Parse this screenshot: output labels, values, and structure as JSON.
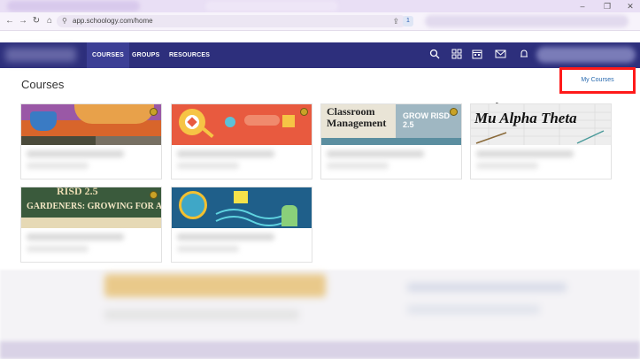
{
  "browser": {
    "url": "app.schoology.com/home",
    "window_controls": [
      "–",
      "❐",
      "✕"
    ],
    "nav": [
      "←",
      "→",
      "↻",
      "⌂"
    ],
    "extension_badge": "1"
  },
  "header": {
    "nav_items": [
      "COURSES",
      "GROUPS",
      "RESOURCES"
    ],
    "icons": [
      "search-icon",
      "apps-icon",
      "calendar-icon",
      "mail-icon",
      "notifications-icon"
    ]
  },
  "main": {
    "title": "Courses",
    "my_courses_label": "My Courses"
  },
  "courses": [
    {
      "banner_text": "",
      "theme": "coffee"
    },
    {
      "banner_text": "",
      "theme": "heart-search"
    },
    {
      "banner_text": "Classroom Management",
      "banner_text_2": "GROW RISD 2.5",
      "theme": "classroom"
    },
    {
      "banner_text": "Mu Alpha Theta",
      "theme": "math"
    },
    {
      "banner_text": "GARDENERS: GROWING FOR ALL",
      "banner_text_top": "RISD 2.5",
      "theme": "gardeners"
    },
    {
      "banner_text": "",
      "theme": "globe"
    }
  ],
  "colors": {
    "header_bg": "#2d2f7c",
    "highlight_box": "#ff1a1a",
    "link": "#2b6cb0"
  }
}
